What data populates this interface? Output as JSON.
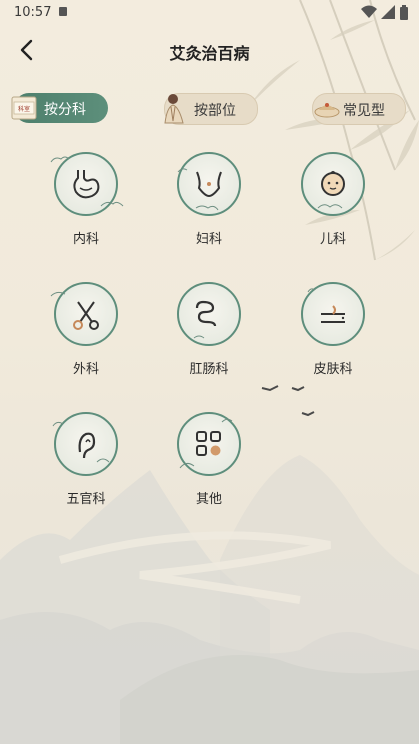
{
  "status_bar": {
    "time": "10:57"
  },
  "header": {
    "title": "艾灸治百病"
  },
  "tabs": [
    {
      "label": "按分科",
      "selected": true
    },
    {
      "label": "按部位",
      "selected": false
    },
    {
      "label": "常见型",
      "selected": false
    }
  ],
  "tab_badge": "科室",
  "categories": [
    {
      "label": "内科",
      "icon": "stomach-icon"
    },
    {
      "label": "妇科",
      "icon": "female-torso-icon"
    },
    {
      "label": "儿科",
      "icon": "baby-face-icon"
    },
    {
      "label": "外科",
      "icon": "scissors-icon"
    },
    {
      "label": "肛肠科",
      "icon": "intestine-icon"
    },
    {
      "label": "皮肤科",
      "icon": "skin-icon"
    },
    {
      "label": "五官科",
      "icon": "ear-icon"
    },
    {
      "label": "其他",
      "icon": "grid-icon"
    }
  ],
  "colors": {
    "accent": "#5e8e7c",
    "tab_active": "#4d7f6c",
    "tab_inactive": "#e7dcc8",
    "background": "#f3ecde"
  }
}
